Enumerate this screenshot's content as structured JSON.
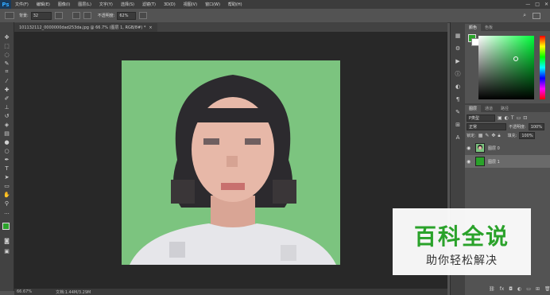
{
  "app": {
    "logo": "Ps"
  },
  "menu": [
    "文件(F)",
    "编辑(E)",
    "图像(I)",
    "图层(L)",
    "文字(Y)",
    "选择(S)",
    "滤镜(T)",
    "3D(D)",
    "视图(V)",
    "窗口(W)",
    "帮助(H)"
  ],
  "window_controls": {
    "minimize": "—",
    "restore": "□",
    "close": "✕"
  },
  "options": {
    "size_label": "背景:",
    "size_value": "32",
    "opacity_label": "不透明度:",
    "opacity_value": "62%"
  },
  "document": {
    "tab_title": "101132112_0000000dad253da.jpg @ 66.7% (图层 1, RGB/8#) *",
    "close": "×"
  },
  "status": {
    "zoom": "66.67%",
    "doc_info": "文档:1.44M/3.29M"
  },
  "color_panel": {
    "tabs": [
      "颜色",
      "色板"
    ]
  },
  "layers_panel": {
    "tabs": [
      "图层",
      "通道",
      "路径"
    ],
    "filter_label": "P类型",
    "blend_mode": "正常",
    "opacity_label": "不透明度:",
    "opacity_value": "100%",
    "lock_label": "锁定:",
    "fill_label": "填充:",
    "fill_value": "100%",
    "layers": [
      {
        "name": "图层 0",
        "selected": false
      },
      {
        "name": "图层 1",
        "selected": true
      }
    ]
  },
  "watermark": {
    "title": "百科全说",
    "subtitle": "助你轻松解决"
  },
  "colors": {
    "background": "#7cc47f",
    "layer1_fill": "#2aa22a",
    "foreground": "#2aa22a"
  }
}
